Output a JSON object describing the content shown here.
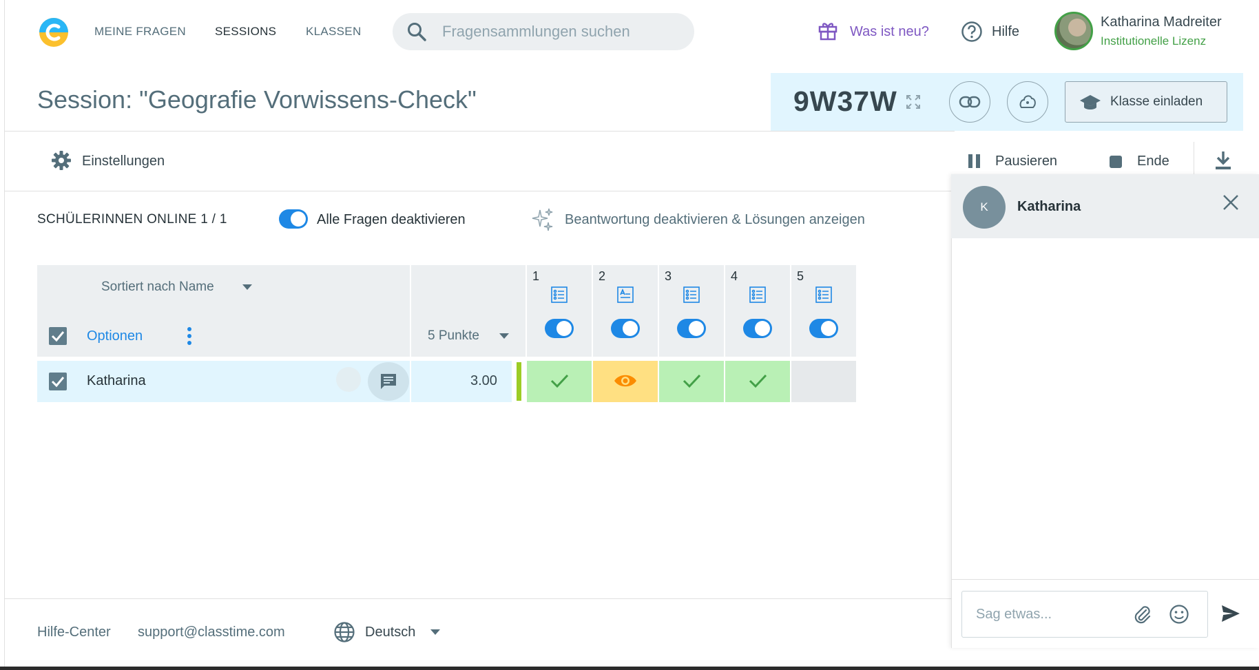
{
  "nav": {
    "items": [
      {
        "label": "MEINE FRAGEN"
      },
      {
        "label": "SESSIONS"
      },
      {
        "label": "KLASSEN"
      }
    ],
    "search_placeholder": "Fragensammlungen suchen",
    "whats_new": "Was ist neu?",
    "help": "Hilfe",
    "user_name": "Katharina Madreiter",
    "license": "Institutionelle Lizenz"
  },
  "header": {
    "title": "Session: \"Geografie Vorwissens-Check\"",
    "code": "9W37W",
    "invite_label": "Klasse einladen"
  },
  "toolbar": {
    "settings": "Einstellungen",
    "pause": "Pausieren",
    "end": "Ende"
  },
  "status": {
    "online": "SCHÜLERINNEN ONLINE 1 / 1",
    "deactivate_all": "Alle Fragen deaktivieren",
    "show_solutions": "Beantwortung deaktivieren & Lösungen anzeigen"
  },
  "table": {
    "sort_label": "Sortiert nach Name",
    "options_label": "Optionen",
    "points_label": "5 Punkte",
    "questions": [
      {
        "number": "1",
        "type": "list-icon"
      },
      {
        "number": "2",
        "type": "text-icon"
      },
      {
        "number": "3",
        "type": "list-icon"
      },
      {
        "number": "4",
        "type": "list-icon"
      },
      {
        "number": "5",
        "type": "list-icon"
      }
    ],
    "rows": [
      {
        "name": "Katharina",
        "score": "3.00",
        "results": [
          "correct",
          "viewing",
          "correct",
          "correct",
          "empty"
        ]
      }
    ]
  },
  "footer": {
    "help_center": "Hilfe-Center",
    "support_email": "support@classtime.com",
    "language": "Deutsch"
  },
  "chat": {
    "avatar_initial": "K",
    "name": "Katharina",
    "input_placeholder": "Sag etwas..."
  },
  "colors": {
    "accent": "#1e88e5",
    "correct": "#b9f0b5",
    "viewing": "#ffe082",
    "empty": "#e6e9eb",
    "code_panel": "#e1f5fe",
    "license_green": "#43a047",
    "whats_new_purple": "#7e57c2"
  }
}
